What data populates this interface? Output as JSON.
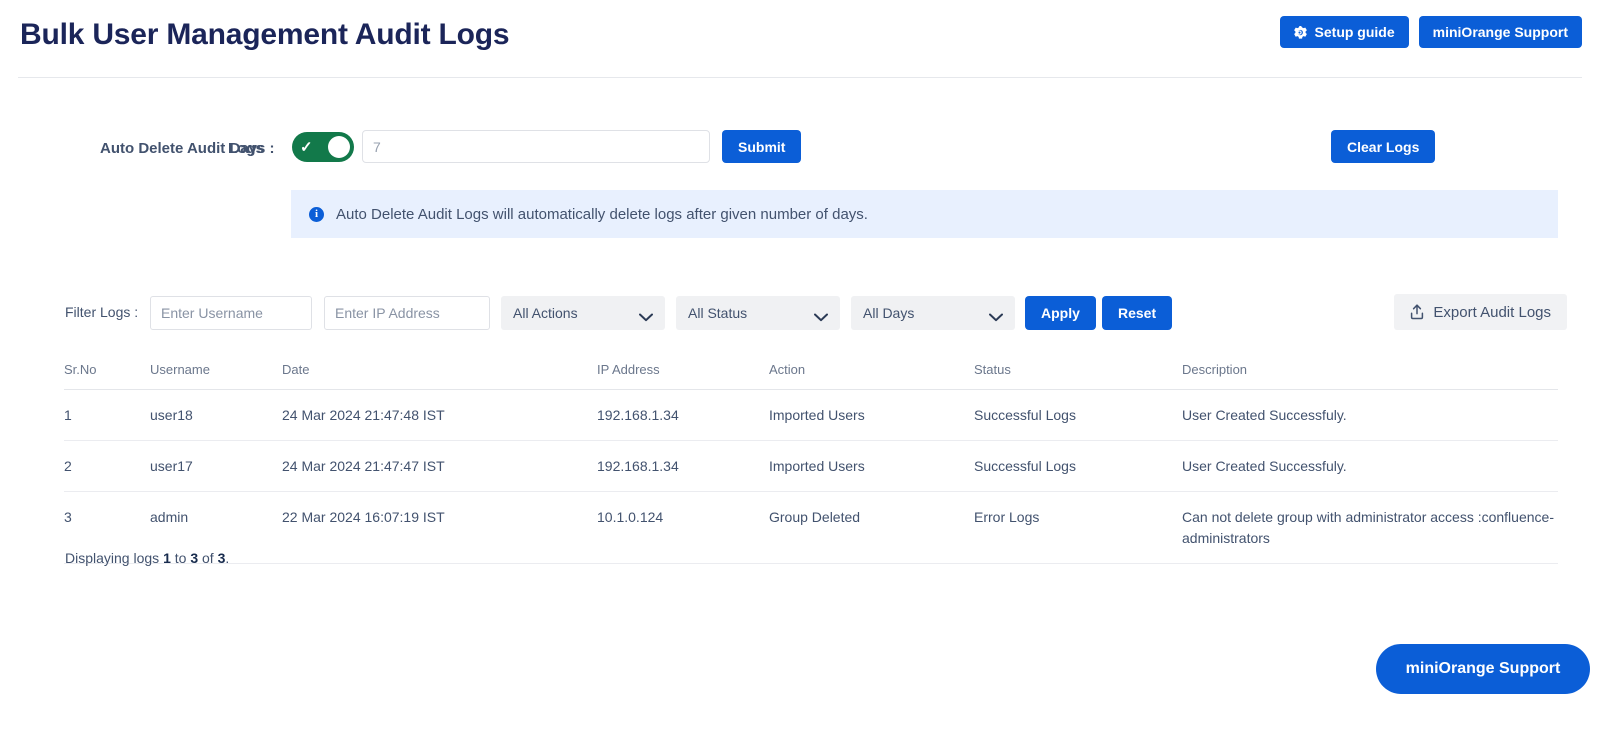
{
  "header": {
    "title": "Bulk User Management Audit Logs",
    "setup_guide_label": "Setup guide",
    "setup_guide_icon": "gear-icon",
    "support_label": "miniOrange Support"
  },
  "auto_delete": {
    "label": "Auto Delete Audit Days :",
    "label_overlay": "Logs",
    "toggle_state": "on",
    "toggle_icon": "check-icon",
    "days_value": "",
    "days_placeholder": "7",
    "submit_label": "Submit",
    "clear_logs_label": "Clear Logs",
    "info_icon": "info-icon",
    "info_text": "Auto Delete Audit Logs will automatically delete logs after given number of days."
  },
  "filters": {
    "label": "Filter Logs :",
    "username_value": "",
    "username_placeholder": "Enter Username",
    "ip_value": "",
    "ip_placeholder": "Enter IP Address",
    "actions_selected": "All Actions",
    "status_selected": "All Status",
    "days_selected": "All Days",
    "apply_label": "Apply",
    "reset_label": "Reset",
    "export_label": "Export Audit Logs",
    "export_icon": "upload-icon",
    "chevron_icon": "chevron-down-icon"
  },
  "table": {
    "headers": [
      "Sr.No",
      "Username",
      "Date",
      "IP Address",
      "Action",
      "Status",
      "Description"
    ],
    "rows": [
      {
        "sr": "1",
        "username": "user18",
        "date": "24 Mar 2024 21:47:48 IST",
        "ip": "192.168.1.34",
        "action": "Imported Users",
        "status": "Successful Logs",
        "description": "User Created Successfuly."
      },
      {
        "sr": "2",
        "username": "user17",
        "date": "24 Mar 2024 21:47:47 IST",
        "ip": "192.168.1.34",
        "action": "Imported Users",
        "status": "Successful Logs",
        "description": "User Created Successfuly."
      },
      {
        "sr": "3",
        "username": "admin",
        "date": "22 Mar 2024 16:07:19 IST",
        "ip": "10.1.0.124",
        "action": "Group Deleted",
        "status": "Error Logs",
        "description": "Can not delete group with administrator access :confluence-administrators"
      }
    ]
  },
  "footer": {
    "displaying_prefix": "Displaying logs ",
    "from": "1",
    "to_word": " to ",
    "to": "3",
    "of_word": " of ",
    "total": "3",
    "suffix": ".",
    "fab_label": "miniOrange Support"
  },
  "colors": {
    "accent_blue": "#0b5ed7",
    "title_navy": "#1b2559",
    "toggle_green": "#12794a",
    "info_bg": "#e8f0fe",
    "text_muted": "#42526e"
  }
}
